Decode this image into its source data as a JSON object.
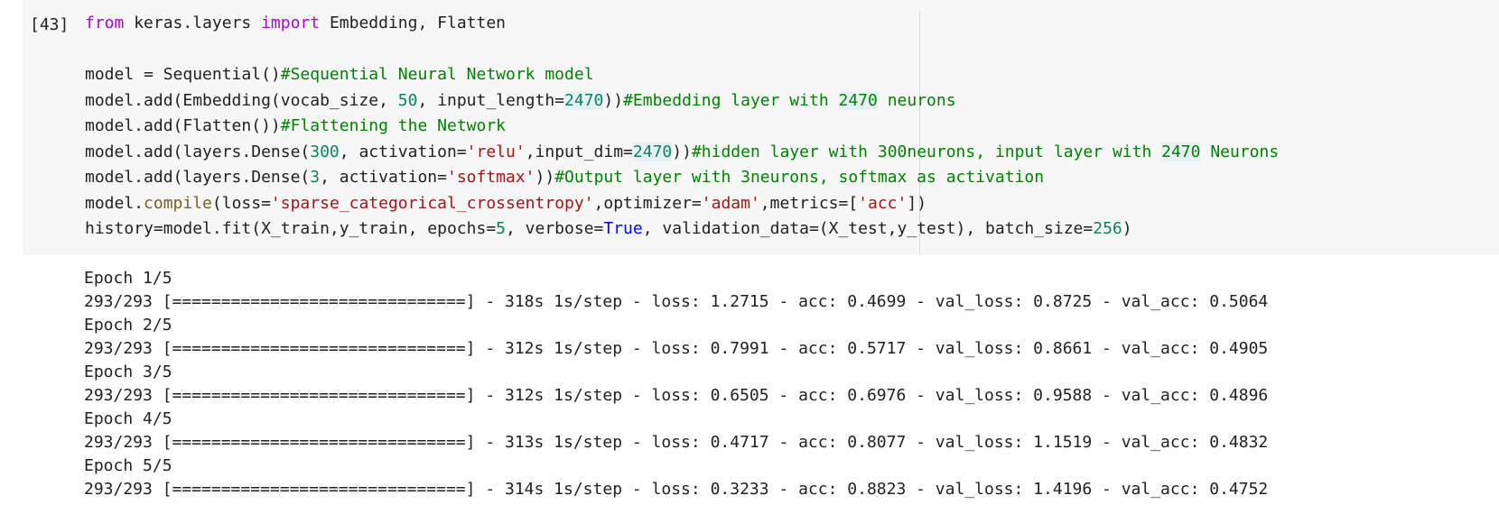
{
  "cell": {
    "execution_count": "[43]",
    "code_lines": [
      [
        {
          "t": "from",
          "c": "kw"
        },
        {
          "t": " keras.layers ",
          "c": ""
        },
        {
          "t": "import",
          "c": "kw"
        },
        {
          "t": " Embedding, Flatten",
          "c": ""
        }
      ],
      [],
      [
        {
          "t": "model = Sequential()",
          "c": ""
        },
        {
          "t": "#Sequential Neural Network model",
          "c": "cm"
        }
      ],
      [
        {
          "t": "model.add(Embedding(vocab_size, ",
          "c": ""
        },
        {
          "t": "50",
          "c": "num"
        },
        {
          "t": ", input_length=",
          "c": ""
        },
        {
          "t": "2470",
          "c": "num hl"
        },
        {
          "t": "))",
          "c": ""
        },
        {
          "t": "#Embedding layer with ",
          "c": "cm"
        },
        {
          "t": "2470",
          "c": "cm hl"
        },
        {
          "t": " neurons",
          "c": "cm"
        }
      ],
      [
        {
          "t": "model.add(Flatten())",
          "c": ""
        },
        {
          "t": "#Flattening the Network",
          "c": "cm"
        }
      ],
      [
        {
          "t": "model.add(layers.Dense(",
          "c": ""
        },
        {
          "t": "300",
          "c": "num"
        },
        {
          "t": ", activation=",
          "c": ""
        },
        {
          "t": "'relu'",
          "c": "str"
        },
        {
          "t": ",input_dim=",
          "c": ""
        },
        {
          "t": "2470",
          "c": "num hl"
        },
        {
          "t": "))",
          "c": ""
        },
        {
          "t": "#hidden layer with 300neurons, input layer with ",
          "c": "cm"
        },
        {
          "t": "2470",
          "c": "cm hl"
        },
        {
          "t": " Neurons",
          "c": "cm"
        }
      ],
      [
        {
          "t": "model.add(layers.Dense(",
          "c": ""
        },
        {
          "t": "3",
          "c": "num"
        },
        {
          "t": ", activation=",
          "c": ""
        },
        {
          "t": "'softmax'",
          "c": "str"
        },
        {
          "t": "))",
          "c": ""
        },
        {
          "t": "#Output layer with 3neurons, softmax as activation",
          "c": "cm"
        }
      ],
      [
        {
          "t": "model.",
          "c": ""
        },
        {
          "t": "compile",
          "c": "fn"
        },
        {
          "t": "(loss=",
          "c": ""
        },
        {
          "t": "'sparse_categorical_crossentropy'",
          "c": "str"
        },
        {
          "t": ",optimizer=",
          "c": ""
        },
        {
          "t": "'adam'",
          "c": "str"
        },
        {
          "t": ",metrics=[",
          "c": ""
        },
        {
          "t": "'acc'",
          "c": "str"
        },
        {
          "t": "])",
          "c": ""
        }
      ],
      [
        {
          "t": "history=model.fit(X_train,y_train, epochs=",
          "c": ""
        },
        {
          "t": "5",
          "c": "num"
        },
        {
          "t": ", verbose=",
          "c": ""
        },
        {
          "t": "True",
          "c": "bi"
        },
        {
          "t": ", validation_data=(X_test,y_test), batch_size=",
          "c": ""
        },
        {
          "t": "256",
          "c": "num"
        },
        {
          "t": ")",
          "c": ""
        }
      ]
    ]
  },
  "output": {
    "lines": [
      "Epoch 1/5",
      "293/293 [==============================] - 318s 1s/step - loss: 1.2715 - acc: 0.4699 - val_loss: 0.8725 - val_acc: 0.5064",
      "Epoch 2/5",
      "293/293 [==============================] - 312s 1s/step - loss: 0.7991 - acc: 0.5717 - val_loss: 0.8661 - val_acc: 0.4905",
      "Epoch 3/5",
      "293/293 [==============================] - 312s 1s/step - loss: 0.6505 - acc: 0.6976 - val_loss: 0.9588 - val_acc: 0.4896",
      "Epoch 4/5",
      "293/293 [==============================] - 313s 1s/step - loss: 0.4717 - acc: 0.8077 - val_loss: 1.1519 - val_acc: 0.4832",
      "Epoch 5/5",
      "293/293 [==============================] - 314s 1s/step - loss: 0.3233 - acc: 0.8823 - val_loss: 1.4196 - val_acc: 0.4752"
    ]
  },
  "colors": {
    "cell_background": "#f7f7f7",
    "keyword": "#af00db",
    "comment": "#008000",
    "number": "#098658",
    "string": "#a31515",
    "builtin": "#0000ff",
    "method": "#795e26"
  }
}
